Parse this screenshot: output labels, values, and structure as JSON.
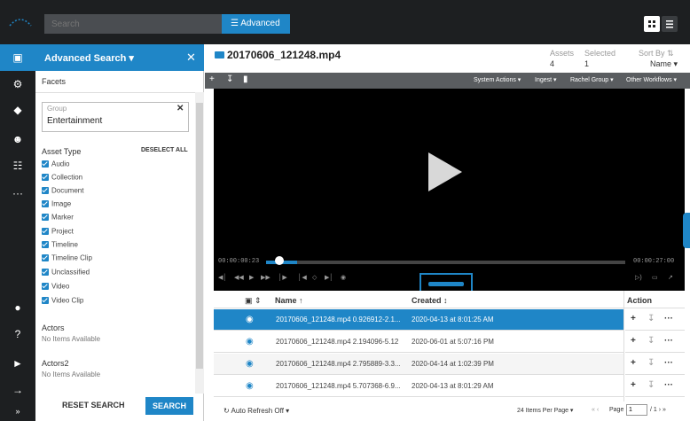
{
  "topbar": {
    "search_placeholder": "Search",
    "advanced_label": "Advanced",
    "advanced_icon": "sliders-icon",
    "view_icons": [
      "grid-view-icon",
      "list-view-icon"
    ]
  },
  "rail": {
    "icons": [
      "image-icon",
      "cogs-icon",
      "tag-icon",
      "users-icon",
      "group-icon",
      "more-icon",
      "help-circle-icon",
      "question-icon",
      "megaphone-icon",
      "sign-in-icon",
      "expand-icon"
    ]
  },
  "adv_search": {
    "title": "Advanced Search ▾",
    "close": "✕",
    "facets_label": "Facets",
    "group": {
      "label": "Group",
      "value": "Entertainment",
      "clear": "✕"
    },
    "asset_type": {
      "label": "Asset Type",
      "deselect_label": "DESELECT ALL",
      "items": [
        "Audio",
        "Collection",
        "Document",
        "Image",
        "Marker",
        "Project",
        "Timeline",
        "Timeline Clip",
        "Unclassified",
        "Video",
        "Video Clip"
      ]
    },
    "actors": {
      "label": "Actors",
      "empty": "No Items Available"
    },
    "actors2": {
      "label": "Actors2",
      "empty": "No Items Available"
    },
    "reset_label": "RESET SEARCH",
    "search_label": "SEARCH"
  },
  "main": {
    "title": "20170606_121248.mp4",
    "title_icon": "video-icon",
    "assets_label": "Assets",
    "assets_value": "4",
    "selected_label": "Selected",
    "selected_value": "1",
    "sortby_label": "Sort By ⇅",
    "sortby_value": "Name ▾"
  },
  "toolbar": {
    "icons": [
      "plus-icon",
      "download-icon",
      "trash-icon"
    ],
    "menus": [
      "System Actions ▾",
      "Ingest ▾",
      "Rachel Group ▾",
      "Other Workflows ▾"
    ]
  },
  "player": {
    "time_start": "00:00:00:23",
    "time_end": "00:00:27:00",
    "progress_fraction": 0.03,
    "controls": [
      "step-back-icon",
      "rewind-icon",
      "play-icon",
      "fast-forward-icon",
      "step-forward-icon",
      "mark-in-icon",
      "mark-clip-icon",
      "mark-out-icon",
      "camera-icon"
    ],
    "right_controls": [
      "volume-icon",
      "subtitles-icon",
      "fullscreen-icon"
    ]
  },
  "table": {
    "headers": {
      "thumb": "▣ ⇕",
      "name": "Name ↑",
      "created": "Created ↕",
      "action": "Action"
    },
    "rows": [
      {
        "name": "20170606_121248.mp4 0.926912-2.1...",
        "created": "2020-04-13 at 8:01:25 AM",
        "selected": true
      },
      {
        "name": "20170606_121248.mp4 2.194096-5.12",
        "created": "2020-06-01 at 5:07:16 PM",
        "selected": false
      },
      {
        "name": "20170606_121248.mp4 2.795889-3.3...",
        "created": "2020-04-14 at 1:02:39 PM",
        "selected": false
      },
      {
        "name": "20170606_121248.mp4 5.707368-6.9...",
        "created": "2020-04-13 at 8:01:29 AM",
        "selected": false
      }
    ],
    "row_icon": "marker-icon",
    "action_icons": [
      "add-icon",
      "download-icon",
      "more-icon"
    ]
  },
  "footer": {
    "auto_refresh": "↻ Auto Refresh Off ▾",
    "per_page": "24 Items Per Page ▾",
    "nav_prev": "« ‹",
    "page_label": "Page",
    "page_value": "1",
    "page_total": "/ 1 › »"
  },
  "colors": {
    "accent": "#1f86c7",
    "topbar": "#1d1f21",
    "toolbar": "#5a5d60"
  }
}
